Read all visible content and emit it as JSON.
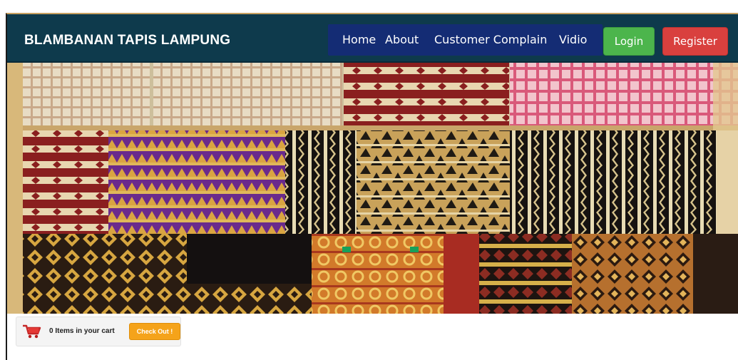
{
  "header": {
    "brand": "BLAMBANAN TAPIS LAMPUNG",
    "nav": {
      "home": "Home",
      "about": "About",
      "customer_complain": "Customer Complain",
      "vidio": "Vidio"
    },
    "login_label": "Login",
    "register_label": "Register"
  },
  "cart": {
    "icon": "shopping-cart-icon",
    "status_text": "0 Items in your cart",
    "checkout_label": "Check Out !"
  },
  "hero": {
    "image": "tapis-lampung-textiles-photo"
  },
  "colors": {
    "navbar": "#0e3a4c",
    "nav_menu": "#142c74",
    "login": "#4cb54c",
    "register": "#d9403e",
    "checkout": "#f5a31a"
  }
}
